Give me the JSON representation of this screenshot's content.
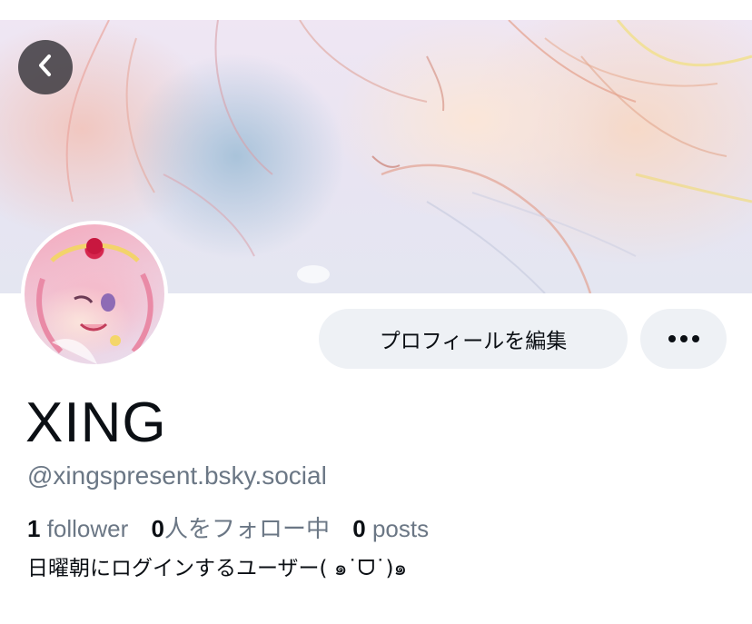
{
  "profile": {
    "display_name": "XING",
    "handle": "@xingspresent.bsky.social",
    "bio": "日曜朝にログインするユーザー( ๑˙ᗜ˙)๑"
  },
  "stats": {
    "followers_count": "1",
    "followers_label": " follower",
    "following_count": "0",
    "following_label": "人をフォロー中",
    "posts_count": "0",
    "posts_label": " posts"
  },
  "actions": {
    "edit_profile_label": "プロフィールを編集",
    "more_icon": "ellipsis-icon",
    "back_icon": "chevron-left-icon"
  },
  "colors": {
    "primary_text": "#0b0f14",
    "secondary_text": "#6b7785",
    "button_bg": "#eef1f5",
    "back_button_bg": "#3c3a40"
  }
}
